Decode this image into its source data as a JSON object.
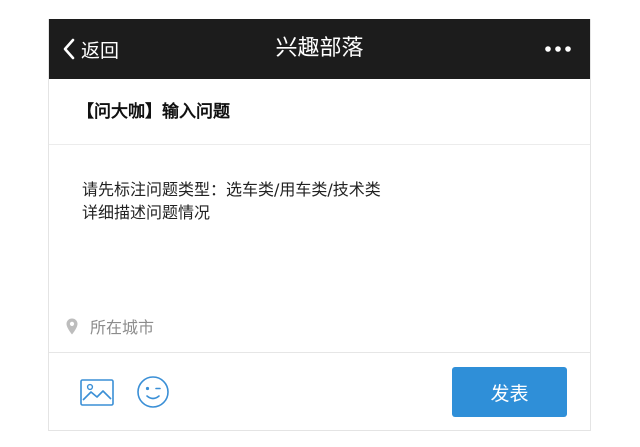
{
  "navbar": {
    "back_label": "返回",
    "title": "兴趣部落",
    "more_icon": "more-horizontal-icon",
    "background": "#1c1c1c"
  },
  "post": {
    "title": "【问大咖】输入问题",
    "body_lines": [
      "请先标注问题类型：选车类/用车类/技术类",
      "详细描述问题情况"
    ]
  },
  "location": {
    "icon": "location-pin-icon",
    "label": "所在城市"
  },
  "toolbar": {
    "image_icon": "image-icon",
    "emoji_icon": "emoji-icon",
    "publish_label": "发表",
    "accent": "#2f8fd8"
  }
}
